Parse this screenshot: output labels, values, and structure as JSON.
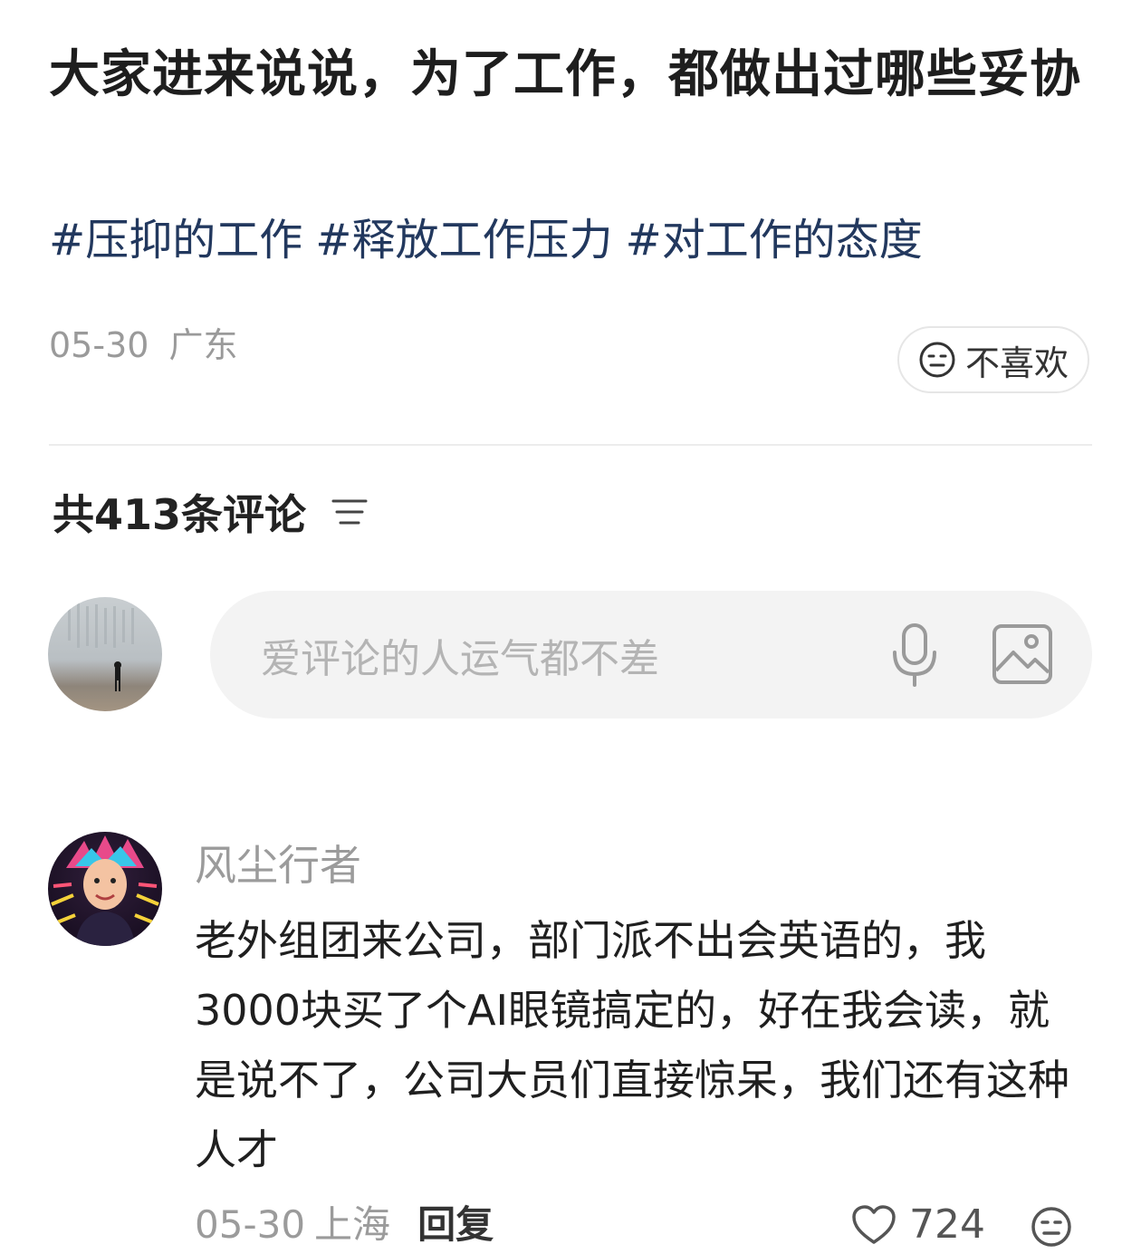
{
  "post": {
    "title": "大家进来说说，为了工作，都做出过哪些妥协",
    "tags": [
      "#压抑的工作",
      "#释放工作压力",
      "#对工作的态度"
    ],
    "date": "05-30",
    "location": "广东",
    "dislike_label": "不喜欢"
  },
  "comments_header": {
    "label": "共413条评论"
  },
  "comment_input": {
    "placeholder": "爱评论的人运气都不差"
  },
  "comment": {
    "username": "风尘行者",
    "text": "老外组团来公司，部门派不出会英语的，我3000块买了个AI眼镜搞定的，好在我会读，就是说不了，公司大员们直接惊呆，我们还有这种人才",
    "date": "05-30",
    "location": "上海",
    "reply_label": "回复",
    "likes": "724"
  },
  "icons": {
    "dislike": "neutral-face-icon",
    "sort": "sort-lines-icon",
    "mic": "microphone-icon",
    "image": "image-icon",
    "like": "heart-icon"
  },
  "colors": {
    "tag": "#22385e",
    "muted": "#9a9a9a",
    "input_bg": "#f3f3f3"
  }
}
